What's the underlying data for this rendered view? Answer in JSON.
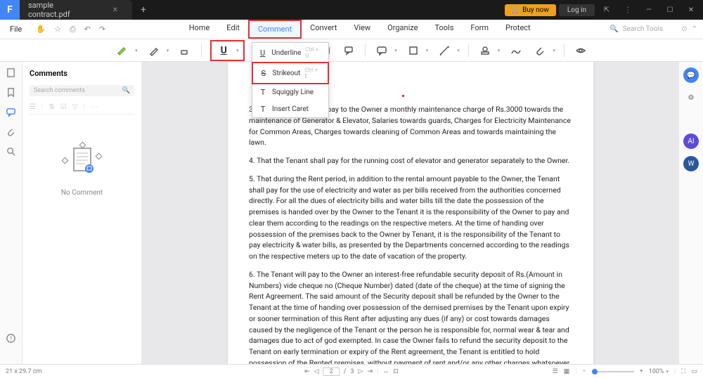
{
  "titlebar": {
    "app_letter": "F",
    "tab_name": "sample contract.pdf",
    "buy_now": "Buy now",
    "login": "Log in"
  },
  "menus": {
    "file": "File",
    "items": [
      "Home",
      "Edit",
      "Comment",
      "Convert",
      "View",
      "Organize",
      "Tools",
      "Form",
      "Protect"
    ],
    "active_index": 2,
    "search_placeholder": "Search Tools"
  },
  "dropdown": {
    "items": [
      {
        "label": "Underline",
        "shortcut": "Ctrl + U",
        "icon": "U"
      },
      {
        "label": "Strikeout",
        "shortcut": "Ctrl + E",
        "icon": "S"
      },
      {
        "label": "Squiggly Line",
        "shortcut": "",
        "icon": "T"
      },
      {
        "label": "Insert Caret",
        "shortcut": "",
        "icon": "T"
      }
    ],
    "highlighted_index": 1
  },
  "comments": {
    "title": "Comments",
    "search_placeholder": "Search comments",
    "empty_text": "No Comment"
  },
  "document": {
    "paragraphs": [
      "3. That the Tenant shall pay to the Owner a monthly maintenance charge of Rs.3000 towards the maintenance of Generator & Elevator, Salaries towards guards, Charges for Electricity Maintenance for Common Areas, Charges towards cleaning of Common Areas and towards maintaining the lawn.",
      "4. That the Tenant shall pay for the running cost of elevator and generator separately to the Owner.",
      "5. That during the Rent period, in addition to the rental amount payable to the Owner, the Tenant shall pay for the use of electricity and water as per bills received from the authorities concerned directly. For all the dues of electricity bills and water bills till the date the possession of the premises is handed over by the Owner to the Tenant it is the responsibility of the Owner to pay and clear them according to the readings on the respective meters. At the time of handing over possession of the premises back to the Owner by Tenant, it is the responsibility of the Tenant to pay electricity & water bills, as presented by the Departments concerned according to the readings on the respective meters up to the date of vacation of the property.",
      "6. The Tenant will pay to the Owner an interest-free refundable security deposit of Rs.(Amount in Numbers) vide cheque no (Cheque Number) dated (date of the cheque) at the time of signing the Rent Agreement. The said amount of the Security deposit shall be refunded by the Owner to the Tenant at the time of handing over possession of the demised premises by the Tenant upon expiry or sooner termination of this Rent after adjusting any dues (if any) or cost towards damages caused by the negligence of the Tenant or the person he is responsible for, normal wear & tear and damages due to act of god exempted. In case the Owner fails to refund the security deposit to the Tenant on early termination or expiry of the Rent agreement, the Tenant is entitled to hold possession of the Rented premises, without payment of rent and/or any other charges whatsoever"
    ]
  },
  "statusbar": {
    "dimensions": "21 x 29.7 cm",
    "page_current": "2",
    "page_total": "3",
    "zoom": "100%"
  }
}
